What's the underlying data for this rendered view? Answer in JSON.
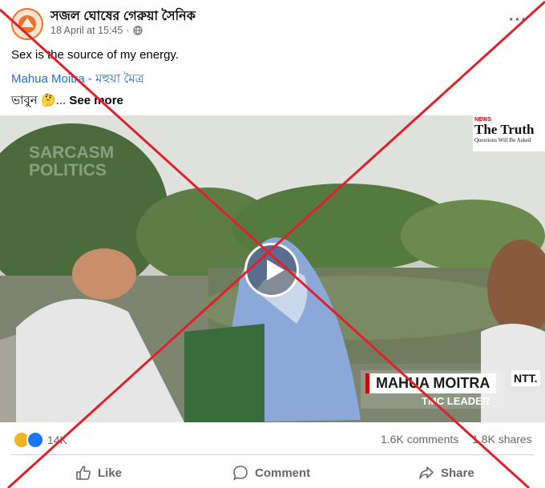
{
  "post": {
    "page_name": "সজল ঘোষের গেরুয়া সৈনিক",
    "timestamp": "18 April at 15:45",
    "privacy_icon": "globe-icon",
    "more_label": "···",
    "text": "Sex is the source of my energy.",
    "tag_link": "Mahua Moitra - মহুয়া মৈত্র",
    "caption_prefix": "ভাবুন 🤔...",
    "see_more": "See more"
  },
  "video": {
    "watermark": "SARCASM POLITICS",
    "logo_title": "The Truth",
    "logo_sub": "Questions Will Be Asked",
    "logo_news": "NEWS",
    "lower_third_name": "MAHUA MOITRA",
    "lower_third_role": "TMC LEADER",
    "corner_tag": "NTT."
  },
  "stats": {
    "reaction_count": "14K",
    "comments": "1.6K comments",
    "shares": "1.8K shares"
  },
  "actions": {
    "like": "Like",
    "comment": "Comment",
    "share": "Share"
  },
  "colors": {
    "link": "#216fdb",
    "cross": "#e0202a",
    "like_blue": "#1877f2",
    "haha_yellow": "#f7b125"
  }
}
